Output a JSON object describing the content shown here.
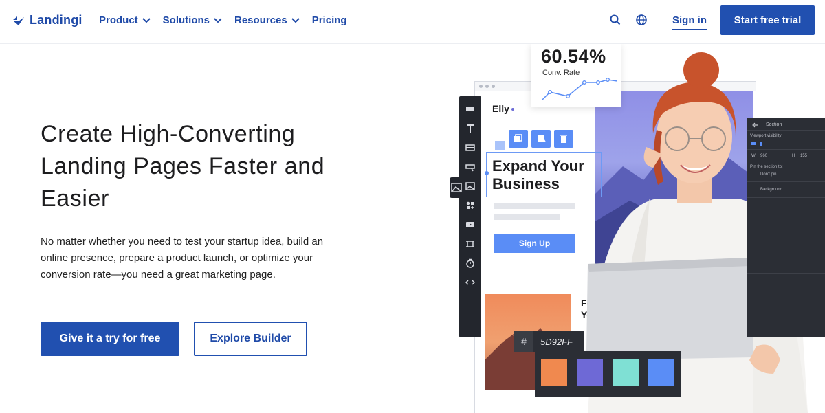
{
  "nav": {
    "brand": "Landingi",
    "menu": [
      {
        "label": "Product",
        "has_dropdown": true
      },
      {
        "label": "Solutions",
        "has_dropdown": true
      },
      {
        "label": "Resources",
        "has_dropdown": true
      },
      {
        "label": "Pricing",
        "has_dropdown": false
      }
    ],
    "signin": "Sign in",
    "trial": "Start free trial"
  },
  "hero": {
    "title": "Create High-Converting Landing Pages Faster and Easier",
    "description": "No matter whether you need to test your startup idea, build an online presence, prepare a product launch, or optimize your conversion rate—you need a great marketing page.",
    "cta_primary": "Give it a try for free",
    "cta_secondary": "Explore Builder"
  },
  "illustration": {
    "rate_value": "60.54%",
    "rate_label": "Conv. Rate",
    "page_brand": "Elly",
    "headline": "Expand Your Business",
    "signup_button": "Sign Up",
    "snippet": "Few\nYou",
    "panel_title": "Section",
    "panel_visibility": "Viewport visibility",
    "panel_w_label": "W",
    "panel_w_value": "960",
    "panel_h_label": "H",
    "panel_h_value": "155",
    "panel_pin_label": "Pin the section to:",
    "panel_pin_value": "Don't pin",
    "panel_background": "Background",
    "hex_symbol": "#",
    "hex_value": "5D92FF",
    "swatches": [
      "#f0894f",
      "#6e69d6",
      "#7fe0d4",
      "#5a8df6"
    ]
  },
  "colors": {
    "brand_blue": "#2150b0",
    "accent_blue": "#5a8df6"
  }
}
